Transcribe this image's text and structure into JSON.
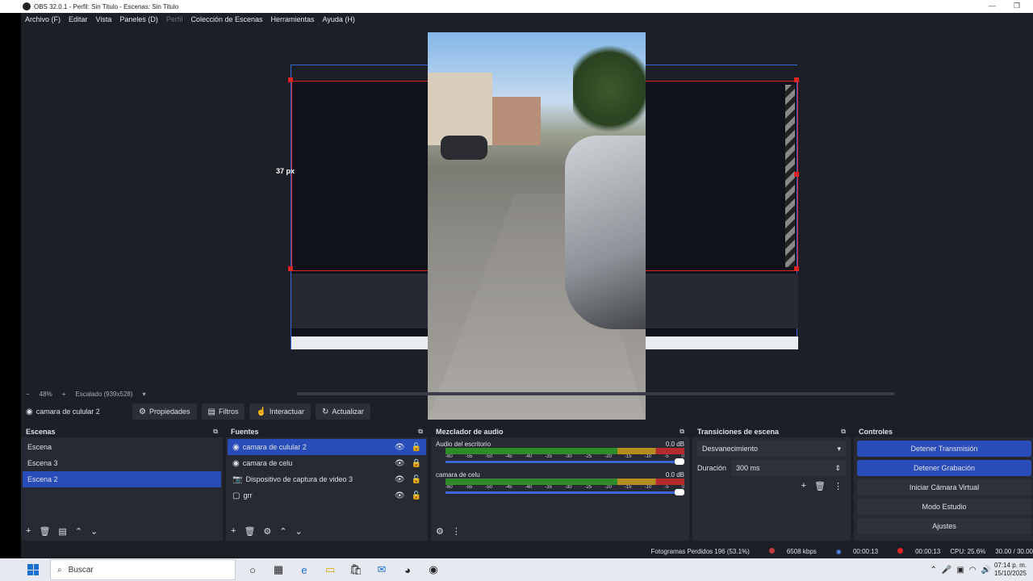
{
  "window": {
    "title": "OBS 32.0.1 - Perfil: Sin Titulo - Escenas: Sin Titulo"
  },
  "menu": [
    "Archivo (F)",
    "Editar",
    "Vista",
    "Paneles (D)",
    "Perfil",
    "Colección de Escenas",
    "Herramientas",
    "Ayuda (H)"
  ],
  "preview": {
    "px_label": "37 px",
    "zoom": "48%",
    "scaled": "Escalado (939x528)"
  },
  "source_bar": {
    "selected_source": "camara de culular 2",
    "buttons": {
      "properties": "Propiedades",
      "filters": "Filtros",
      "interact": "Interactuar",
      "refresh": "Actualizar"
    }
  },
  "scenes": {
    "title": "Escenas",
    "items": [
      "Escena",
      "Escena 3",
      "Escena 2"
    ],
    "selected": 2
  },
  "sources": {
    "title": "Fuentes",
    "items": [
      "camara de culular 2",
      "camara de celu",
      "Dispositivo de captura de video 3",
      "grr"
    ],
    "selected": 0
  },
  "mixer": {
    "title": "Mezclador de audio",
    "tracks": [
      {
        "name": "Audio del escritorio",
        "db": "0.0 dB"
      },
      {
        "name": "camara de celu",
        "db": "0.0 dB"
      }
    ],
    "ticks": [
      "-60",
      "-55",
      "-50",
      "-45",
      "-40",
      "-35",
      "-30",
      "-25",
      "-20",
      "-15",
      "-10",
      "-5",
      "0"
    ]
  },
  "transitions": {
    "title": "Transiciones de escena",
    "type": "Desvanecimiento",
    "duration_label": "Duración",
    "duration": "300 ms"
  },
  "controls": {
    "title": "Controles",
    "buttons": [
      "Detener Transmisión",
      "Detener Grabación",
      "Iniciar Cámara Virtual",
      "Modo Estudio",
      "Ajustes"
    ]
  },
  "status": {
    "dropped": "Fotogramas Perdidos 196 (53.1%)",
    "bitrate": "6508 kbps",
    "stream_time": "00:00:13",
    "rec_time": "00:00:13",
    "cpu": "CPU: 25.6%",
    "fps": "30.00 / 30.00"
  },
  "taskbar": {
    "search": "Buscar",
    "time": "07:14 p. m.",
    "date": "15/10/2025"
  }
}
